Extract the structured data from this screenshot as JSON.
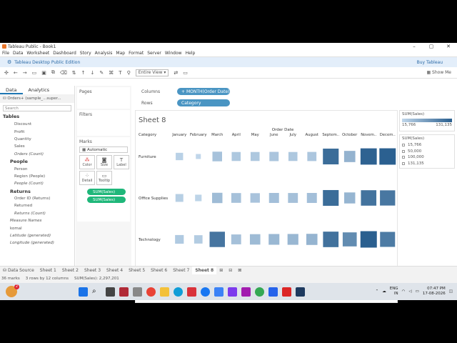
{
  "window": {
    "title": "Tableau Public - Book1"
  },
  "menu": [
    "File",
    "Data",
    "Worksheet",
    "Dashboard",
    "Story",
    "Analysis",
    "Map",
    "Format",
    "Server",
    "Window",
    "Help"
  ],
  "banner": {
    "text": "Tableau Desktop Public Edition",
    "buy": "Buy Tableau"
  },
  "toolbar": {
    "fit": "Entire View",
    "show_me": "Show Me"
  },
  "data_pane": {
    "tabs": [
      "Data",
      "Analytics"
    ],
    "source": "Orders+ (sample_...super...",
    "search_placeholder": "Search",
    "tables_label": "Tables",
    "orders_fields": [
      "Discount",
      "Profit",
      "Quantity",
      "Sales",
      "Orders (Count)"
    ],
    "people_label": "People",
    "people_fields": [
      "Person",
      "Region (People)",
      "People (Count)"
    ],
    "returns_label": "Returns",
    "returns_fields": [
      "Order ID (Returns)",
      "Returned",
      "Returns (Count)"
    ],
    "extra_fields": [
      "Measure Names",
      "komal",
      "Latitude (generated)",
      "Longitude (generated)"
    ]
  },
  "cards": {
    "pages": "Pages",
    "filters": "Filters",
    "marks": "Marks",
    "marks_type": "Automatic",
    "buttons": [
      "Color",
      "Size",
      "Label",
      "Detail",
      "Tooltip"
    ],
    "pills": [
      "SUM(Sales)",
      "SUM(Sales)"
    ]
  },
  "shelves": {
    "columns_label": "Columns",
    "columns_pill": "MONTH(Order Date)",
    "rows_label": "Rows",
    "rows_pill": "Category"
  },
  "chart_data": {
    "type": "heatmap",
    "title": "Sheet 8",
    "xlabel": "Order Date",
    "ylabel": "Category",
    "categories": [
      "January",
      "February",
      "March",
      "April",
      "May",
      "June",
      "July",
      "August",
      "Septem..",
      "October",
      "Novem..",
      "Decem.."
    ],
    "series": [
      {
        "name": "Furniture",
        "values": [
          21000,
          16000,
          35000,
          30000,
          30000,
          32000,
          30000,
          31000,
          118000,
          50000,
          128000,
          130000
        ]
      },
      {
        "name": "Office Supplies",
        "values": [
          23000,
          18000,
          41000,
          36000,
          34000,
          38000,
          37000,
          38000,
          118000,
          48000,
          112000,
          108000
        ]
      },
      {
        "name": "Technology",
        "values": [
          28000,
          26000,
          110000,
          37000,
          42000,
          45000,
          46000,
          49000,
          113000,
          88000,
          131135,
          104000
        ]
      }
    ],
    "color_legend": {
      "title": "SUM(Sales)",
      "min": "15,766",
      "max": "131,135",
      "colors": [
        "#c0d6ea",
        "#2a5f8f"
      ]
    },
    "size_legend": {
      "title": "SUM(Sales)",
      "items": [
        "15,766",
        "50,000",
        "100,000",
        "131,135"
      ]
    }
  },
  "sheet_tabs": [
    "Data Source",
    "Sheet 1",
    "Sheet 2",
    "Sheet 3",
    "Sheet 4",
    "Sheet 5",
    "Sheet 6",
    "Sheet 7",
    "Sheet 8"
  ],
  "status": {
    "marks": "36 marks",
    "rows": "3 rows by 12 columns",
    "sum": "SUM(Sales): 2,297,201"
  },
  "taskbar": {
    "badge": "2",
    "lang": "ENG",
    "region": "IN",
    "time": "07:47 PM",
    "date": "17-08-2026"
  }
}
